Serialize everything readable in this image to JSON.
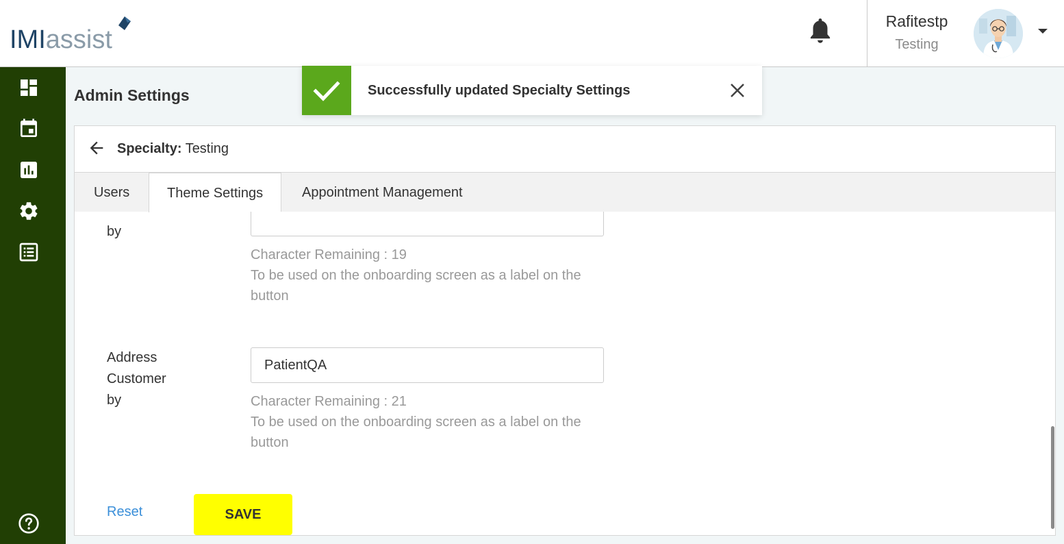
{
  "header": {
    "logo_imi": "IMI",
    "logo_assist": "assist",
    "user_name": "Rafitestp",
    "user_role": "Testing"
  },
  "sidebar": {
    "items": [
      {
        "icon": "dashboard-icon"
      },
      {
        "icon": "calendar-icon"
      },
      {
        "icon": "bar-chart-icon"
      },
      {
        "icon": "gear-icon"
      },
      {
        "icon": "list-icon"
      },
      {
        "icon": "help-icon"
      }
    ]
  },
  "page": {
    "title": "Admin Settings"
  },
  "card": {
    "specialty_label": "Specialty:",
    "specialty_value": "Testing",
    "tabs": [
      {
        "label": "Users",
        "active": false
      },
      {
        "label": "Theme Settings",
        "active": true
      },
      {
        "label": "Appointment Management",
        "active": false
      }
    ]
  },
  "form": {
    "field1": {
      "label_tail": "by",
      "value": "",
      "remaining": "Character Remaining : 19",
      "hint_line1": "To be used on the onboarding screen as a label on the",
      "hint_line2": "button"
    },
    "field2": {
      "label_line1": "Address",
      "label_line2": "Customer",
      "label_line3": "by",
      "value": "PatientQA",
      "remaining": "Character Remaining : 21",
      "hint_line1": "To be used on the onboarding screen as a label on the",
      "hint_line2": "button"
    },
    "reset_label": "Reset",
    "save_label": "SAVE"
  },
  "toast": {
    "message": "Successfully updated Specialty Settings",
    "type": "success",
    "color": "#5ba81c"
  },
  "colors": {
    "sidebar": "#213f04",
    "save_button": "#ffff00",
    "link": "#3b8fd9"
  }
}
